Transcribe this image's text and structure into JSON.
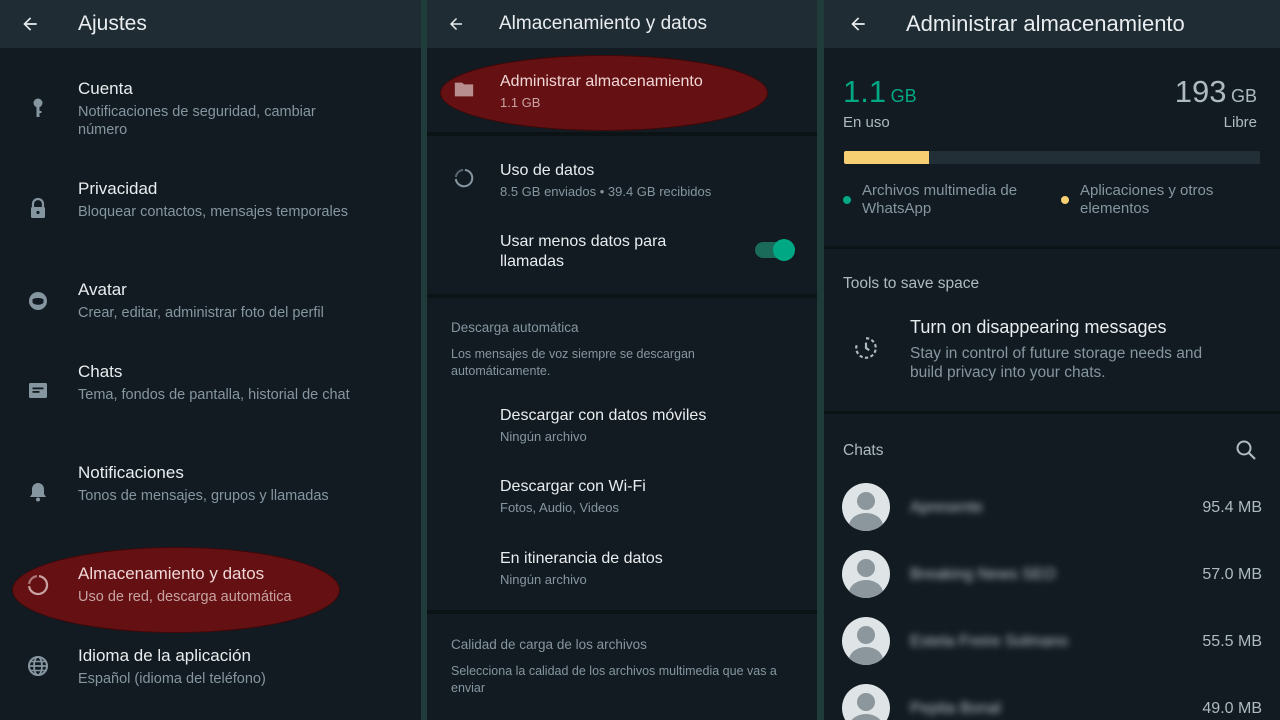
{
  "settings": {
    "title": "Ajustes",
    "items": [
      {
        "title": "Cuenta",
        "subtitle": "Notificaciones de seguridad, cambiar número",
        "icon": "key-icon"
      },
      {
        "title": "Privacidad",
        "subtitle": "Bloquear contactos, mensajes temporales",
        "icon": "lock-icon"
      },
      {
        "title": "Avatar",
        "subtitle": "Crear, editar, administrar foto del perfil",
        "icon": "avatar-icon"
      },
      {
        "title": "Chats",
        "subtitle": "Tema, fondos de pantalla, historial de chat",
        "icon": "chat-icon"
      },
      {
        "title": "Notificaciones",
        "subtitle": "Tonos de mensajes, grupos y llamadas",
        "icon": "bell-icon"
      },
      {
        "title": "Almacenamiento y datos",
        "subtitle": "Uso de red, descarga automática",
        "icon": "data-usage-icon"
      },
      {
        "title": "Idioma de la aplicación",
        "subtitle": "Español (idioma del teléfono)",
        "icon": "globe-icon"
      }
    ]
  },
  "storage_data": {
    "title": "Almacenamiento y datos",
    "manage": {
      "title": "Administrar almacenamiento",
      "subtitle": "1.1 GB"
    },
    "data_usage": {
      "title": "Uso de datos",
      "subtitle": "8.5 GB enviados • 39.4 GB recibidos"
    },
    "less_data_calls": {
      "title": "Usar menos datos para llamadas",
      "enabled": true
    },
    "auto_download": {
      "header": "Descarga automática",
      "description": "Los mensajes de voz siempre se descargan automáticamente.",
      "items": [
        {
          "title": "Descargar con datos móviles",
          "subtitle": "Ningún archivo"
        },
        {
          "title": "Descargar con Wi-Fi",
          "subtitle": "Fotos, Audio, Videos"
        },
        {
          "title": "En itinerancia de datos",
          "subtitle": "Ningún archivo"
        }
      ]
    },
    "upload_quality": {
      "header": "Calidad de carga de los archivos",
      "description": "Selecciona la calidad de los archivos multimedia que vas a enviar"
    }
  },
  "manage_storage": {
    "title": "Administrar almacenamiento",
    "used_value": "1.1",
    "used_unit": "GB",
    "used_label": "En uso",
    "free_value": "193",
    "free_unit": "GB",
    "free_label": "Libre",
    "usage_fraction": 0.205,
    "legend": [
      {
        "label": "Archivos multimedia de WhatsApp",
        "color": "#00a884"
      },
      {
        "label": "Aplicaciones y otros elementos",
        "color": "#f5cf72"
      }
    ],
    "tools_header": "Tools to save space",
    "tool": {
      "title": "Turn on disappearing messages",
      "subtitle": "Stay in control of future storage needs and build privacy into your chats."
    },
    "chats_header": "Chats",
    "chats": [
      {
        "name": "Apresente",
        "size": "95.4 MB"
      },
      {
        "name": "Breaking News SEO",
        "size": "57.0 MB"
      },
      {
        "name": "Estela Freire Solmano",
        "size": "55.5 MB"
      },
      {
        "name": "Pepita Bonal",
        "size": "49.0 MB"
      }
    ]
  },
  "colors": {
    "accent": "#00a884",
    "highlight": "#7a1010",
    "background": "#121b22"
  }
}
